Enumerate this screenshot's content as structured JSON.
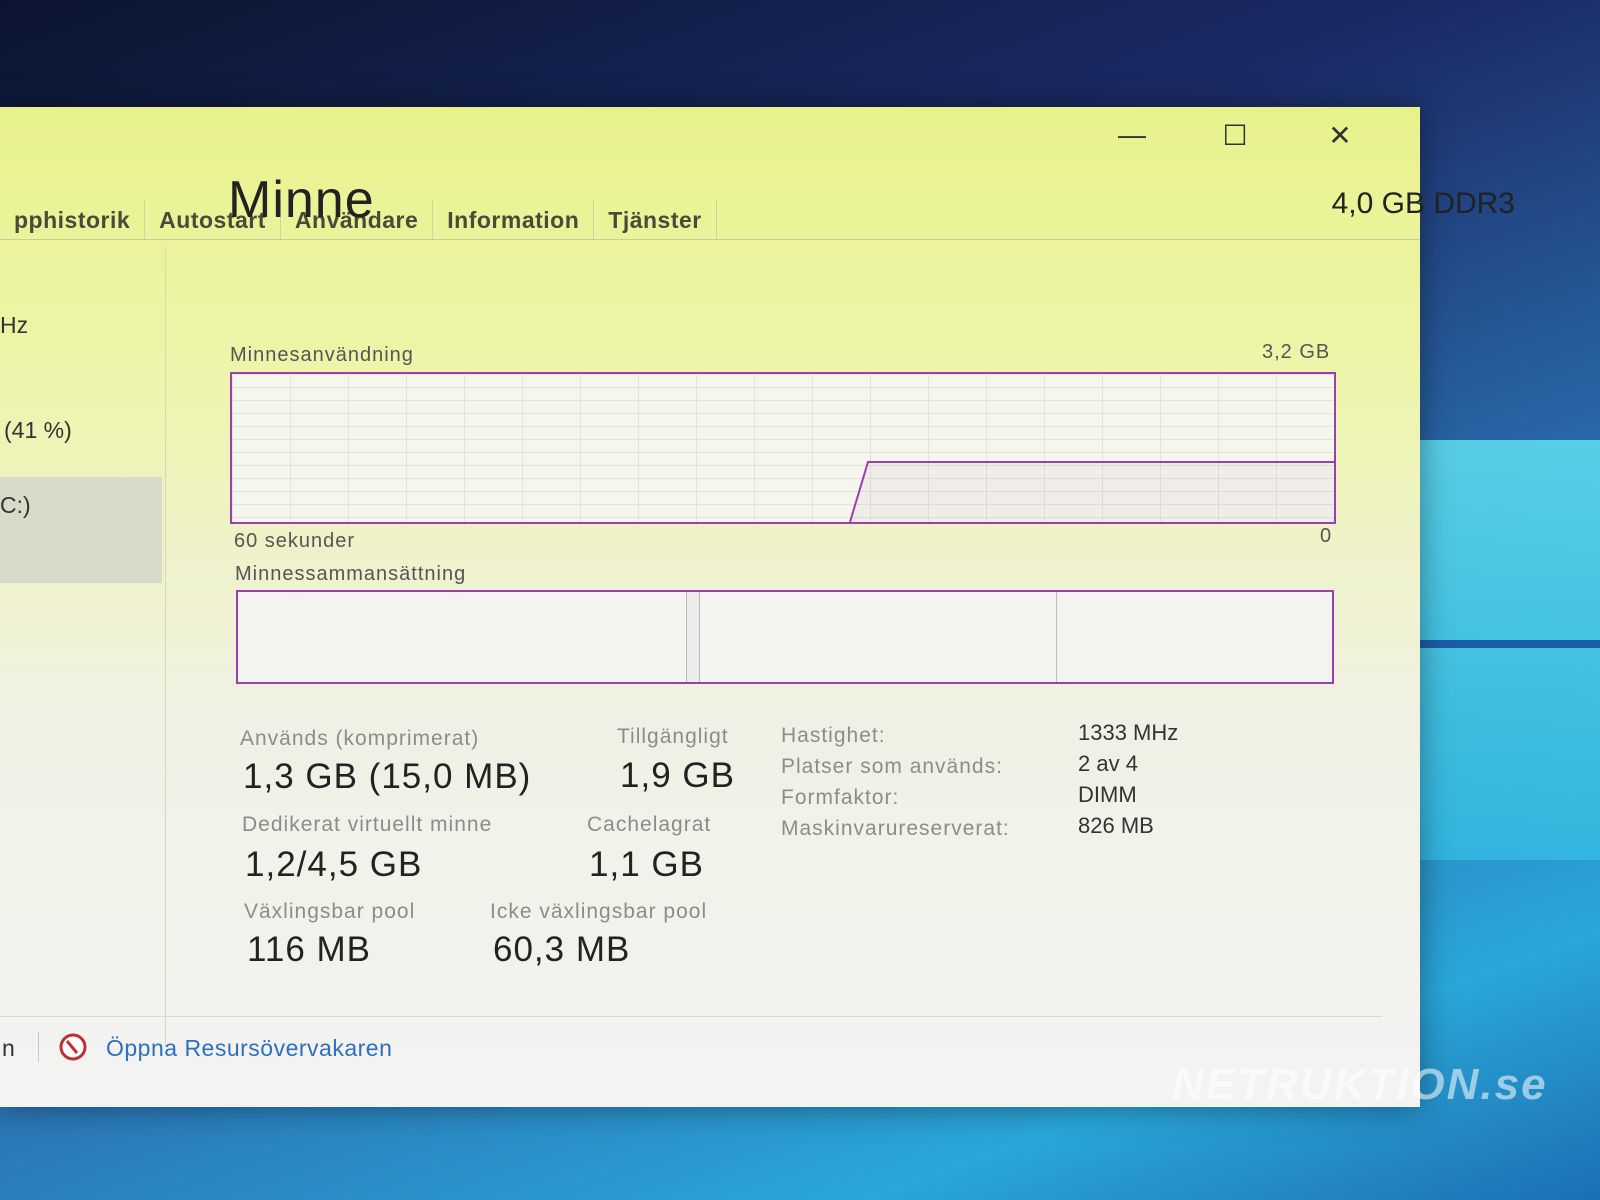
{
  "window": {
    "controls": {
      "minimize": "—",
      "maximize": "☐",
      "close": "✕"
    },
    "tabs": [
      "pphistorik",
      "Autostart",
      "Användare",
      "Information",
      "Tjänster"
    ]
  },
  "sidebar": {
    "items": [
      {
        "label": "Hz"
      },
      {
        "label": "(41 %)",
        "selected": true
      },
      {
        "label": "C:)"
      }
    ]
  },
  "memory": {
    "title": "Minne",
    "total": "4,0 GB DDR3",
    "usage_label": "Minnesanvändning",
    "usage_max": "3,2 GB",
    "time_label": "60 sekunder",
    "time_zero": "0",
    "composition_label": "Minnessammansättning",
    "stats": {
      "used_label": "Används (komprimerat)",
      "used_value": "1,3 GB (15,0 MB)",
      "available_label": "Tillgängligt",
      "available_value": "1,9 GB",
      "committed_label": "Dedikerat virtuellt minne",
      "committed_value": "1,2/4,5 GB",
      "cached_label": "Cachelagrat",
      "cached_value": "1,1 GB",
      "paged_label": "Växlingsbar pool",
      "paged_value": "116 MB",
      "nonpaged_label": "Icke växlingsbar pool",
      "nonpaged_value": "60,3 MB"
    },
    "details": [
      {
        "label": "Hastighet:",
        "value": "1333 MHz"
      },
      {
        "label": "Platser som används:",
        "value": "2 av 4"
      },
      {
        "label": "Formfaktor:",
        "value": "DIMM"
      },
      {
        "label": "Maskinvarureserverat:",
        "value": "826 MB"
      }
    ]
  },
  "footer": {
    "left_text": "n",
    "link": "Öppna Resursövervakaren",
    "icon": "resource-monitor-icon"
  },
  "watermark": "NETRUKTION.se",
  "colors": {
    "graph_line": "#9a3fb0",
    "link": "#2e6fbf"
  }
}
